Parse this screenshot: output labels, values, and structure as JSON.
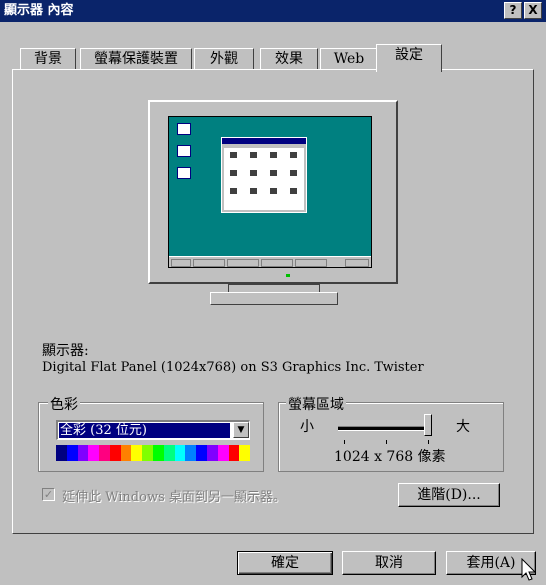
{
  "window": {
    "title": "顯示器 內容",
    "help_btn": "?",
    "close_btn": "X"
  },
  "tabs": [
    {
      "label": "背景"
    },
    {
      "label": "螢幕保護裝置"
    },
    {
      "label": "外觀"
    },
    {
      "label": "效果"
    },
    {
      "label": "Web"
    },
    {
      "label": "設定"
    }
  ],
  "active_tab": "設定",
  "display": {
    "label": "顯示器:",
    "device": "Digital Flat Panel (1024x768) on S3 Graphics Inc. Twister"
  },
  "colors": {
    "group_label": "色彩",
    "selected": "全彩 (32 位元)"
  },
  "screen_area": {
    "group_label": "螢幕區域",
    "min_label": "小",
    "max_label": "大",
    "resolution": "1024 x 768 像素"
  },
  "extend": {
    "label": "延伸此 Windows 桌面到另一顯示器。",
    "checked": true,
    "enabled": false
  },
  "buttons": {
    "advanced": "進階(D)...",
    "ok": "確定",
    "cancel": "取消",
    "apply": "套用(A)"
  },
  "palette": [
    "#000080",
    "#0000ff",
    "#8000ff",
    "#ff00ff",
    "#ff0080",
    "#ff0000",
    "#ff8000",
    "#ffff00",
    "#80ff00",
    "#00ff00",
    "#00ff80",
    "#00ffff",
    "#0080ff",
    "#0000ff",
    "#8000ff",
    "#ff00ff",
    "#ff0000",
    "#ffff00"
  ]
}
